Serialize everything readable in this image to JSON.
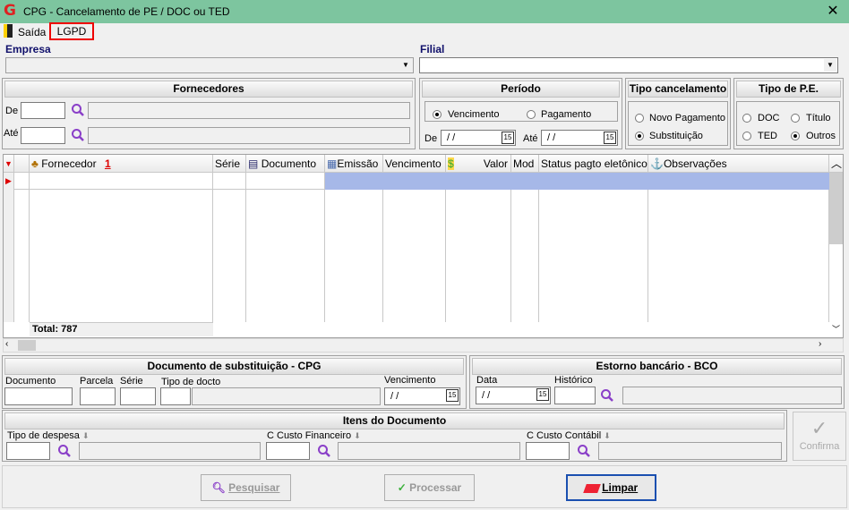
{
  "window": {
    "title": "CPG - Cancelamento de PE / DOC ou TED",
    "close": "✕"
  },
  "menu": {
    "exit": "Saída",
    "lgpd": "LGPD"
  },
  "company": {
    "label": "Empresa",
    "branch_label": "Filial"
  },
  "suppliers": {
    "title": "Fornecedores",
    "from": "De",
    "to": "Até"
  },
  "period": {
    "title": "Período",
    "due": "Vencimento",
    "payment": "Pagamento",
    "from": "De",
    "to": "Até",
    "from_value": "/ /",
    "to_value": "/ /"
  },
  "cancel_type": {
    "title": "Tipo cancelamento",
    "new_payment": "Novo Pagamento",
    "substitution": "Substituição"
  },
  "pe_type": {
    "title": "Tipo de P.E.",
    "doc": "DOC",
    "titulo": "Título",
    "ted": "TED",
    "outros": "Outros"
  },
  "grid": {
    "headers": {
      "fornecedor": "Fornecedor",
      "sort": "1",
      "serie": "Série",
      "documento": "Documento",
      "emissao": "Emissão",
      "vencimento": "Vencimento",
      "valor": "Valor",
      "mod": "Mod",
      "status": "Status pagto eletônico",
      "obs": "Observações"
    },
    "total": "Total: 787"
  },
  "substitution_doc": {
    "title": "Documento de substituição - CPG",
    "documento": "Documento",
    "parcela": "Parcela",
    "serie": "Série",
    "tipo": "Tipo de docto",
    "vencimento": "Vencimento",
    "date_value": "/ /"
  },
  "bank_reversal": {
    "title": "Estorno bancário  - BCO",
    "data": "Data",
    "historico": "Histórico",
    "date_value": "/ /"
  },
  "doc_items": {
    "title": "Itens do Documento",
    "tipo_despesa": "Tipo de despesa",
    "custo_fin": "C Custo Financeiro",
    "custo_cont": "C Custo Contábil"
  },
  "confirm": "Confirma",
  "buttons": {
    "search": "Pesquisar",
    "process": "Processar",
    "clear": "Limpar"
  }
}
